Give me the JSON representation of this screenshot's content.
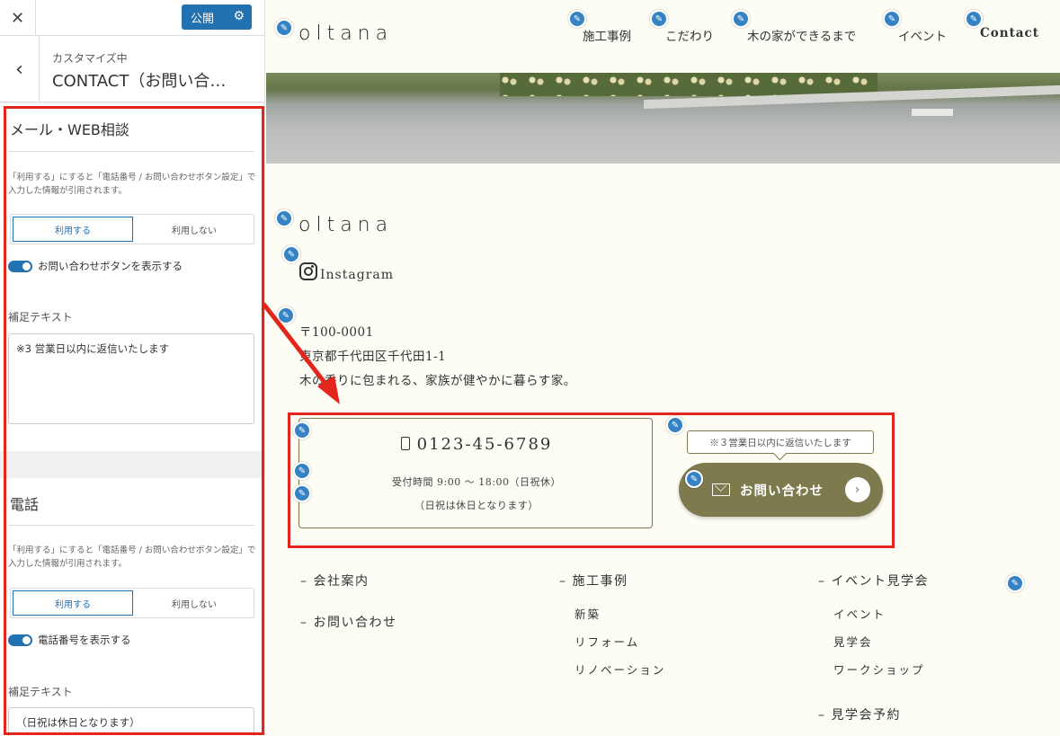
{
  "panel": {
    "close_icon": "✕",
    "publish_label": "公開",
    "gear_icon": "⚙",
    "back_icon": "‹",
    "head_sub": "カスタマイズ中",
    "head_title": "CONTACT（お問い合…",
    "mail_section": {
      "title": "メール・WEB相談",
      "desc": "「利用する」にすると「電話番号 / お問い合わせボタン設定」で入力した情報が引用されます。",
      "seg_on": "利用する",
      "seg_off": "利用しない",
      "toggle_label": "お問い合わせボタンを表示する",
      "field_label": "補足テキスト",
      "field_value": "※3 営業日以内に返信いたします"
    },
    "tel_section": {
      "title": "電話",
      "desc": "「利用する」にすると「電話番号 / お問い合わせボタン設定」で入力した情報が引用されます。",
      "seg_on": "利用する",
      "seg_off": "利用しない",
      "toggle_label": "電話番号を表示する",
      "field_label": "補足テキスト",
      "field_value": "（日祝は休日となります）"
    }
  },
  "preview": {
    "logo": "oltana",
    "nav": [
      "施工事例",
      "こだわり",
      "木の家ができるまで",
      "イベント",
      "Contact"
    ],
    "pencil_icon": "✎",
    "footer_logo": "oltana",
    "instagram_label": "Instagram",
    "address": [
      "〒100-0001",
      "東京都千代田区千代田1-1",
      "木の香りに包まれる、家族が健やかに暮らす家。"
    ],
    "tel_number": "0123-45-6789",
    "tel_hours": "受付時間 9:00 〜 18:00（日祝休）",
    "tel_note": "（日祝は休日となります）",
    "tooltip": "※３営業日以内に返信いたします",
    "contact_button": "お問い合わせ",
    "contact_arrow": "›",
    "footer": {
      "col1": [
        "– 会社案内",
        "– お問い合わせ"
      ],
      "col2_head": "– 施工事例",
      "col2_items": [
        "新築",
        "リフォーム",
        "リノベーション"
      ],
      "col3_head": "– イベント見学会",
      "col3_items": [
        "イベント",
        "見学会",
        "ワークショップ"
      ],
      "col3_head2": "– 見学会予約"
    }
  },
  "colors": {
    "accent_blue": "#2271b1",
    "highlight_red": "#e3261b",
    "olive": "#7d7a4e"
  }
}
